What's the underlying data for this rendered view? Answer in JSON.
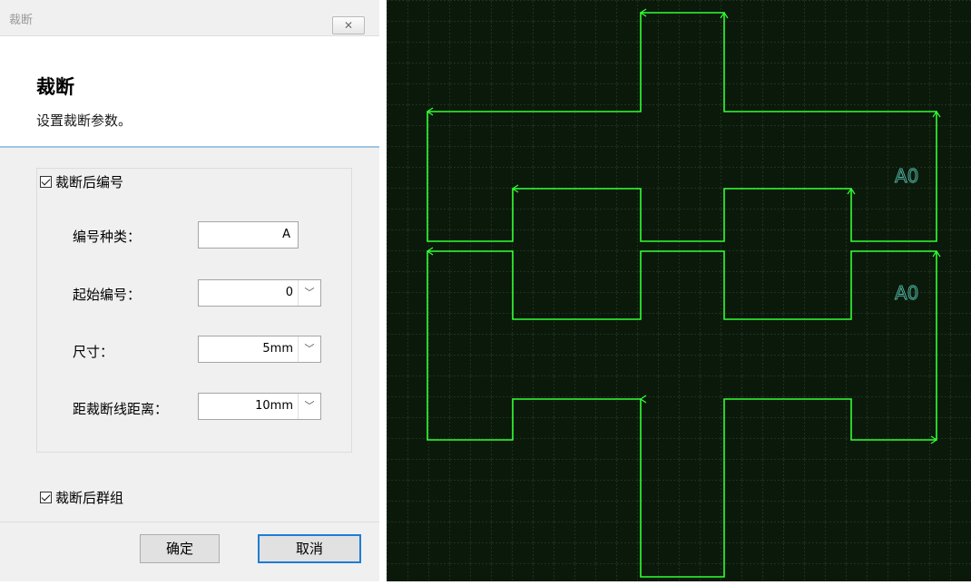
{
  "window": {
    "title": "裁断",
    "close_glyph": "✕"
  },
  "header": {
    "title": "裁断",
    "subtitle": "设置裁断参数。"
  },
  "options": {
    "number_after_cut": {
      "label": "裁断后编号",
      "checked": true
    },
    "group_after_cut": {
      "label": "裁断后群组",
      "checked": true
    }
  },
  "fields": {
    "number_type": {
      "label": "编号种类：",
      "value": "A"
    },
    "start_number": {
      "label": "起始编号：",
      "value": "0"
    },
    "size": {
      "label": "尺寸：",
      "value": "5mm"
    },
    "distance": {
      "label": "距裁断线距离：",
      "value": "10mm"
    }
  },
  "buttons": {
    "ok": "确定",
    "cancel": "取消"
  },
  "canvas": {
    "background": "#0b190b",
    "grid_color": "#2f4a2f",
    "shape_color": "#33ff33",
    "label_color": "#4fb0a0",
    "labels": [
      "A0",
      "A0"
    ]
  }
}
